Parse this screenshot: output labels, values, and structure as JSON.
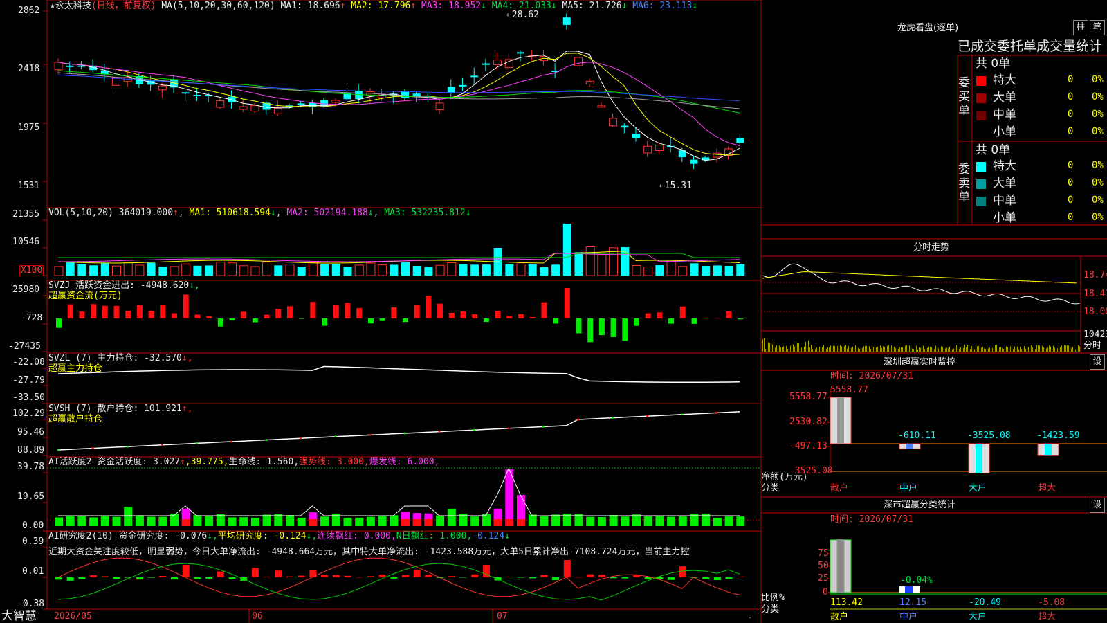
{
  "colors": {
    "up": "#ff3232",
    "down": "#00ffff",
    "grid": "#c00000",
    "ma_white": "#ffffff",
    "ma_yellow": "#ffff00",
    "ma_magenta": "#ff40ff",
    "ma_green": "#00dd00",
    "ma_gray": "#a0a0a0",
    "ma_blue": "#3050ff",
    "pos": "#ff1010",
    "neg": "#00ee00"
  },
  "main": {
    "star": "★",
    "stock_name": "永太科技",
    "period": "(日线，前复权)",
    "ma_label": "MA(5,10,20,30,60,120)",
    "ma": [
      {
        "t": "MA1: 18.696",
        "a": "↑"
      },
      {
        "t": "MA2: 17.796",
        "a": "↑"
      },
      {
        "t": "MA3: 18.952",
        "a": "↓"
      },
      {
        "t": "MA4: 21.033",
        "a": "↓"
      },
      {
        "t": "MA5: 21.726",
        "a": "↓"
      },
      {
        "t": "MA6: 23.113",
        "a": "↓"
      }
    ],
    "y_ticks": [
      "2862",
      "2418",
      "1975",
      "1531"
    ],
    "high_label": "28.62",
    "low_label": "←15.31",
    "high_arrow": "←"
  },
  "vol": {
    "title": "VOL(5,10,20)",
    "value": "364019.000",
    "up": "↑",
    "ma": [
      {
        "t": "MA1: 510618.594",
        "a": "↓"
      },
      {
        "t": "MA2: 502194.188",
        "a": "↓"
      },
      {
        "t": "MA3: 532235.812",
        "a": "↓"
      }
    ],
    "y_ticks": [
      "21355",
      "10546"
    ],
    "unit": "X100"
  },
  "svzj": {
    "title": "SVZJ  活跃资金进出: -4948.620",
    "arrow": "↓,",
    "sub": "超赢资金流(万元)",
    "y_ticks": [
      "25980",
      "-728",
      "-27435"
    ]
  },
  "svzl": {
    "title": "SVZL (7) 主力持仓: -32.570",
    "arrow": "↓,",
    "sub": "超赢主力持仓",
    "y_ticks": [
      "-22.08",
      "-27.79",
      "-33.50"
    ]
  },
  "svsh": {
    "title": "SVSH (7) 散户持仓: 101.921",
    "arrow": "↑,",
    "sub": "超赢散户持仓",
    "y_ticks": [
      "102.29",
      "95.46",
      "88.89"
    ]
  },
  "ai1": {
    "title": "AI活跃度2 资金活跃度: 3.027",
    "arrow1": "↑",
    "v2": ",39.775,",
    "v3": "生命线: 1.560,",
    "v4": "强势线: 3.000,",
    "v5": "爆发线: 6.000,",
    "y_ticks": [
      "39.78",
      "19.65",
      "0.00"
    ]
  },
  "ai2": {
    "title": "AI研究度2(10) 资金研究度: -0.076",
    "a1": "↓,",
    "v2": "平均研究度: -0.124",
    "a2": "↓,",
    "v3": "连续飘红: 0.000,",
    "v4": "N日飘红: 1.000,",
    "v5": "-0.124",
    "a5": "↓",
    "comment": "近期大资金关注度较低，明显弱势，今日大单净流出: -4948.664万元，其中特大单净流出: -1423.588万元，大单5日累计净出-7108.724万元，当前主力控",
    "y_ticks": [
      "0.39",
      "0.01",
      "-0.38"
    ]
  },
  "xaxis": {
    "labels": [
      "2026/05",
      "06",
      "07"
    ]
  },
  "brand": "大智慧",
  "longhu": {
    "title": "龙虎看盘(逐单)",
    "btn1": "柱",
    "btn2": "笔",
    "subtitle": "已成交委托单成交量统计",
    "buy": {
      "side": "委买单",
      "total": "共 0单",
      "rows": [
        {
          "name": "特大",
          "v": "0",
          "p": "0%",
          "c": "#ff0000"
        },
        {
          "name": "大单",
          "v": "0",
          "p": "0%",
          "c": "#a00000"
        },
        {
          "name": "中单",
          "v": "0",
          "p": "0%",
          "c": "#700000"
        },
        {
          "name": "小单",
          "v": "0",
          "p": "0%",
          "c": "#000000"
        }
      ]
    },
    "sell": {
      "side": "委卖单",
      "total": "共 0单",
      "rows": [
        {
          "name": "特大",
          "v": "0",
          "p": "0%",
          "c": "#00ffff"
        },
        {
          "name": "大单",
          "v": "0",
          "p": "0%",
          "c": "#00a0a0"
        },
        {
          "name": "中单",
          "v": "0",
          "p": "0%",
          "c": "#008080"
        },
        {
          "name": "小单",
          "v": "0",
          "p": "0%",
          "c": "#000000"
        }
      ]
    }
  },
  "intraday": {
    "title": "分时走势",
    "p1": "18.74",
    "p2": "18.41",
    "p3": "18.08",
    "vol": "10423",
    "vol_unit": "分时"
  },
  "monitor": {
    "title": "深圳超赢实时监控",
    "btn": "设",
    "time": "时间: 2026/07/31",
    "y_ticks": [
      "5558.77",
      "2530.82",
      "-497.13",
      "-3525.08"
    ],
    "top_value": "5558.77",
    "ylabel1": "净额(万元)",
    "ylabel2": "分类",
    "chart_data": {
      "type": "bar",
      "categories": [
        "散户",
        "中户",
        "大户",
        "超大"
      ],
      "values": [
        5558.77,
        -610.11,
        -3525.08,
        -1423.59
      ],
      "value_labels": [
        "",
        "-610.11",
        "-3525.08",
        "-1423.59"
      ],
      "ylim": [
        -3525.08,
        5558.77
      ],
      "xlabel": "分类",
      "ylabel": "净额(万元)"
    }
  },
  "classify": {
    "title": "深市超赢分类统计",
    "btn": "设",
    "time": "时间: 2026/07/31",
    "y_ticks": [
      "75",
      "50",
      "25",
      "0"
    ],
    "ylabel1": "比例%",
    "ylabel2": "分类",
    "chart_data": {
      "type": "bar",
      "categories": [
        "散户",
        "中户",
        "大户",
        "超大"
      ],
      "values": [
        113.42,
        12.15,
        -20.49,
        -5.08
      ],
      "ylim": [
        0,
        75
      ],
      "bar_label": "-0.04%",
      "xlabel": "分类",
      "ylabel": "比例%"
    }
  }
}
